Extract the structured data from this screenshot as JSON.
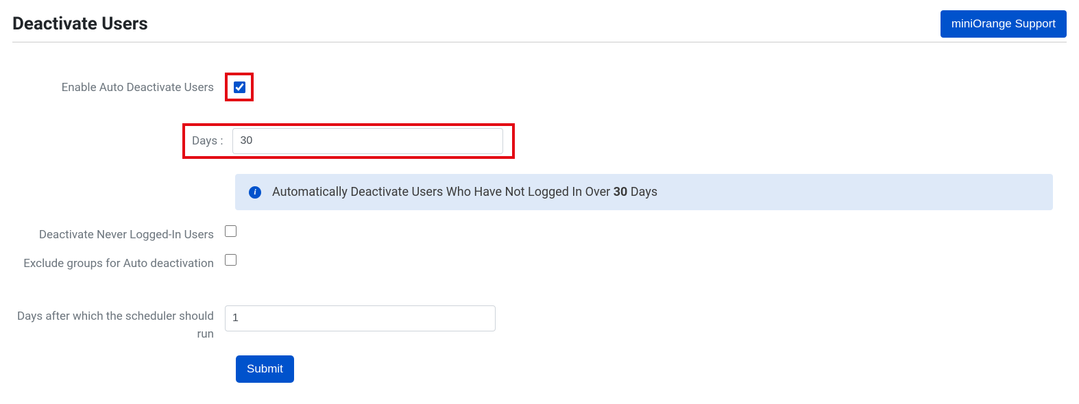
{
  "header": {
    "title": "Deactivate Users",
    "support_label": "miniOrange Support"
  },
  "form": {
    "enable_auto_label": "Enable Auto Deactivate Users",
    "enable_auto_checked": true,
    "days_label": "Days :",
    "days_value": "30",
    "info_prefix": "Automatically Deactivate Users Who Have Not Logged In Over ",
    "info_bold": "30",
    "info_suffix": " Days",
    "never_logged_label": "Deactivate Never Logged-In Users",
    "never_logged_checked": false,
    "exclude_groups_label": "Exclude groups for Auto deactivation",
    "exclude_groups_checked": false,
    "scheduler_label": "Days after which the scheduler should run",
    "scheduler_value": "1",
    "submit_label": "Submit"
  }
}
